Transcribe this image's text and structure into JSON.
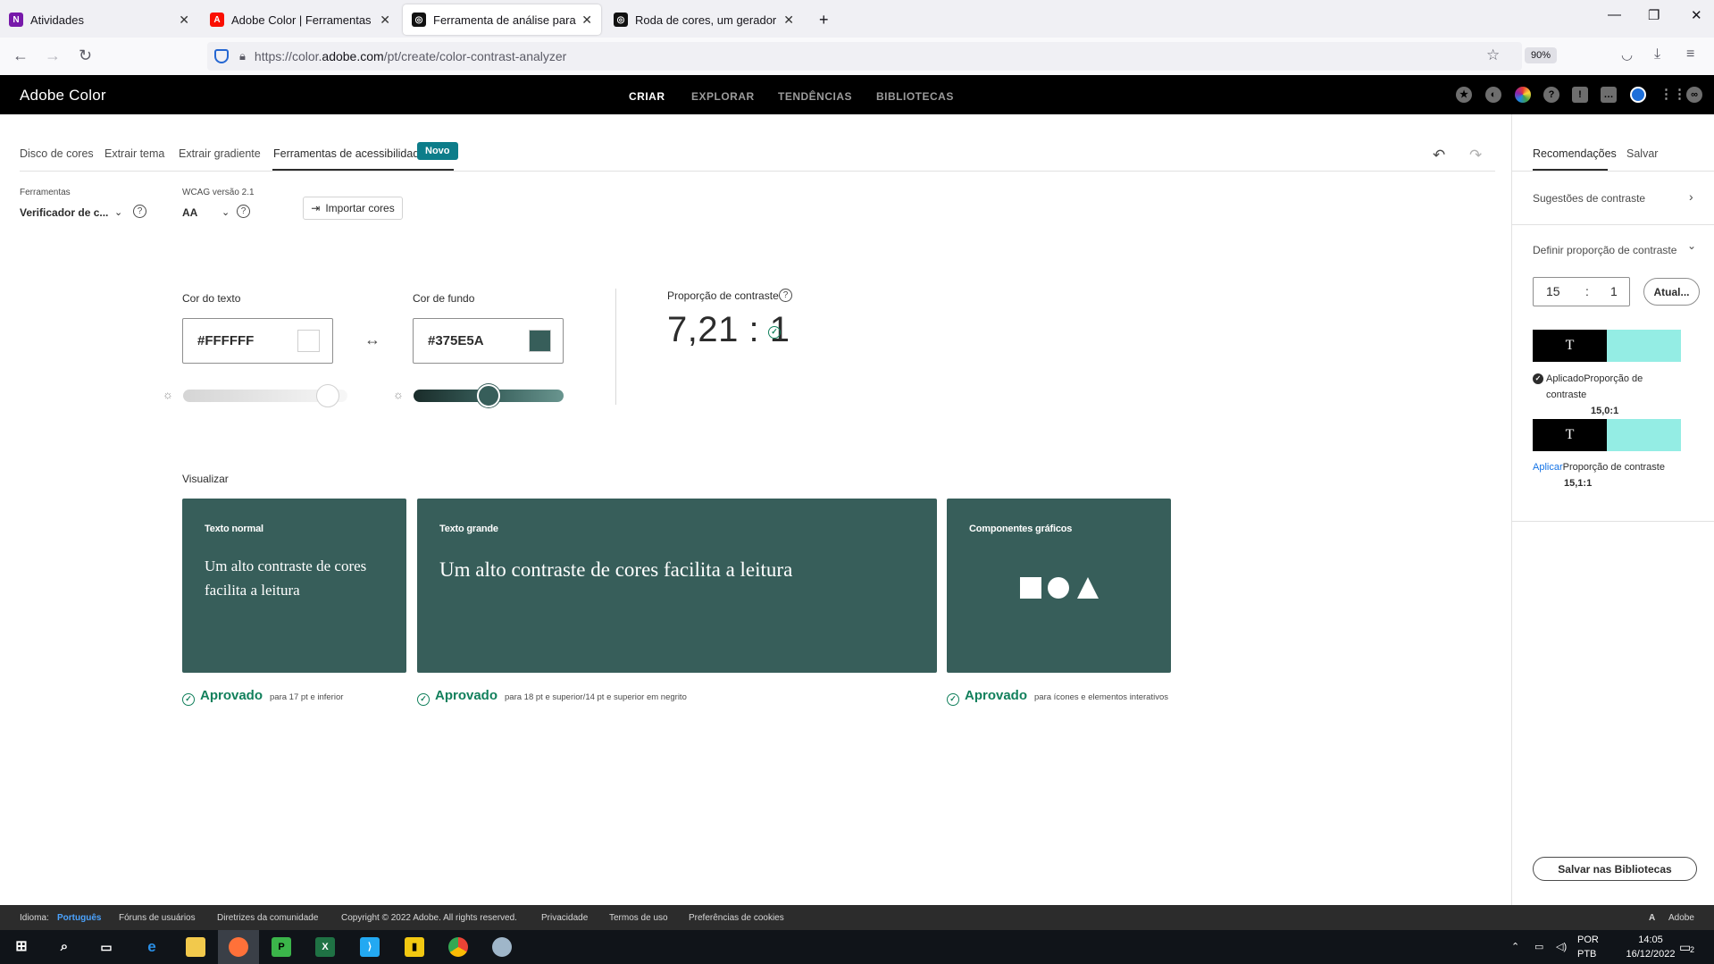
{
  "browser": {
    "tabs": [
      {
        "title": "Atividades"
      },
      {
        "title": "Adobe Color | Ferramentas de a"
      },
      {
        "title": "Ferramenta de análise para verif"
      },
      {
        "title": "Roda de cores, um gerador de p"
      }
    ],
    "url_prefix": "https://color.",
    "url_domain": "adobe.com",
    "url_path": "/pt/create/color-contrast-analyzer",
    "zoom": "90%"
  },
  "app": {
    "brand": "Adobe Color",
    "nav": [
      "CRIAR",
      "EXPLORAR",
      "TENDÊNCIAS",
      "BIBLIOTECAS"
    ]
  },
  "subtabs": [
    "Disco de cores",
    "Extrair tema",
    "Extrair gradiente",
    "Ferramentas de acessibilidade"
  ],
  "novo_badge": "Novo",
  "tools": {
    "label": "Ferramentas",
    "value": "Verificador de c...",
    "wcag_label": "WCAG versão 2.1",
    "wcag_value": "AA",
    "import_label": "Importar cores"
  },
  "text_color": {
    "label": "Cor do texto",
    "value": "#FFFFFF",
    "swatch": "#ffffff",
    "brightness": 0.88
  },
  "bg_color": {
    "label": "Cor de fundo",
    "value": "#375E5A",
    "swatch": "#375e5a",
    "brightness": 0.5
  },
  "contrast": {
    "label": "Proporção de contraste",
    "value": "7,21 : 1"
  },
  "preview": {
    "label": "Visualizar",
    "cards": [
      {
        "title": "Texto normal",
        "text": "Um alto contraste de cores facilita a leitura",
        "status": "Aprovado",
        "note": "para 17 pt e inferior"
      },
      {
        "title": "Texto grande",
        "text": "Um alto contraste de cores facilita a leitura",
        "status": "Aprovado",
        "note": "para 18 pt e superior/14 pt e superior em negrito"
      },
      {
        "title": "Componentes gráficos",
        "text": "",
        "status": "Aprovado",
        "note": "para ícones e elementos interativos"
      }
    ]
  },
  "right_panel": {
    "tabs": [
      "Recomendações",
      "Salvar"
    ],
    "suggestions": "Sugestões de contraste",
    "define": "Definir proporção de contraste",
    "ratio_left": "15",
    "ratio_sep": ":",
    "ratio_right": "1",
    "update": "Atual...",
    "pair1": {
      "letter": "T",
      "status": "Aplicado",
      "caption": "Proporção de contraste",
      "ratio": "15,0:1"
    },
    "pair2": {
      "letter": "T",
      "status": "Aplicar",
      "caption": "Proporção de contraste",
      "ratio": "15,1:1"
    },
    "save_libraries": "Salvar nas Bibliotecas"
  },
  "footer": {
    "lang_label": "Idioma:",
    "lang_value": "Português",
    "links": [
      "Fóruns de usuários",
      "Diretrizes da comunidade",
      "Copyright © 2022 Adobe. All rights reserved.",
      "Privacidade",
      "Termos de uso",
      "Preferências de cookies"
    ],
    "adobe": "Adobe"
  },
  "taskbar": {
    "lang1": "POR",
    "lang2": "PTB",
    "time": "14:05",
    "date": "16/12/2022",
    "notifications": "2"
  },
  "colors": {
    "accent": "#0d7d8a",
    "pass": "#12805c",
    "card_bg": "#375e5a",
    "suggest": "#94ede4"
  }
}
